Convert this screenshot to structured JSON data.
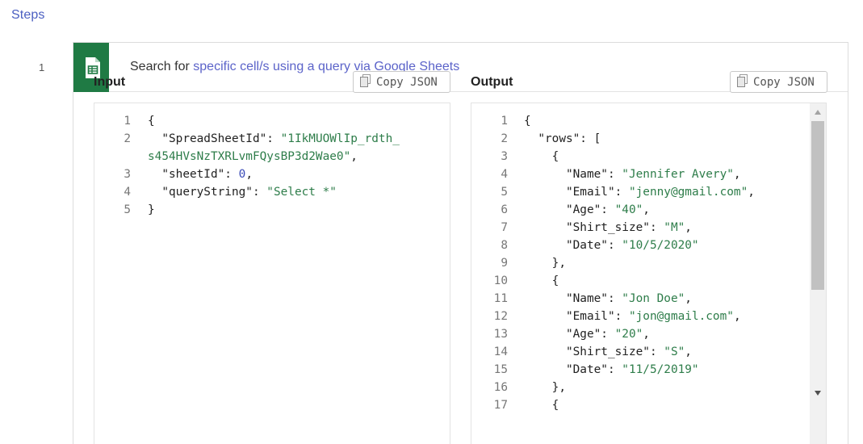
{
  "steps_heading": "Steps",
  "step": {
    "number": "1",
    "app_icon": "google-sheets-icon",
    "app_color": "#1f7a44",
    "title_prefix": "Search for ",
    "title_link": "specific cell/s using a query via Google Sheets"
  },
  "input": {
    "label": "Input",
    "copy_label": "Copy JSON",
    "lines": [
      {
        "n": "1",
        "parts": [
          [
            "code",
            "{"
          ]
        ]
      },
      {
        "n": "2",
        "parts": [
          [
            "code",
            "  \"SpreadSheetId\": "
          ],
          [
            "str",
            "\"1IkMUOWlIp_rdth_"
          ]
        ]
      },
      {
        "n": "",
        "parts": [
          [
            "str",
            "s454HVsNzTXRLvmFQysBP3d2Wae0\""
          ],
          [
            "code",
            ","
          ]
        ]
      },
      {
        "n": "3",
        "parts": [
          [
            "code",
            "  \"sheetId\": "
          ],
          [
            "num",
            "0"
          ],
          [
            "code",
            ","
          ]
        ]
      },
      {
        "n": "4",
        "parts": [
          [
            "code",
            "  \"queryString\": "
          ],
          [
            "str",
            "\"Select *\""
          ]
        ]
      },
      {
        "n": "5",
        "parts": [
          [
            "code",
            "}"
          ]
        ]
      }
    ]
  },
  "output": {
    "label": "Output",
    "copy_label": "Copy JSON",
    "lines": [
      {
        "n": "1",
        "parts": [
          [
            "code",
            "{"
          ]
        ]
      },
      {
        "n": "2",
        "parts": [
          [
            "code",
            "  \"rows\": ["
          ]
        ]
      },
      {
        "n": "3",
        "parts": [
          [
            "code",
            "    {"
          ]
        ]
      },
      {
        "n": "4",
        "parts": [
          [
            "code",
            "      \"Name\": "
          ],
          [
            "str",
            "\"Jennifer Avery\""
          ],
          [
            "code",
            ","
          ]
        ]
      },
      {
        "n": "5",
        "parts": [
          [
            "code",
            "      \"Email\": "
          ],
          [
            "str",
            "\"jenny@gmail.com\""
          ],
          [
            "code",
            ","
          ]
        ]
      },
      {
        "n": "6",
        "parts": [
          [
            "code",
            "      \"Age\": "
          ],
          [
            "str",
            "\"40\""
          ],
          [
            "code",
            ","
          ]
        ]
      },
      {
        "n": "7",
        "parts": [
          [
            "code",
            "      \"Shirt_size\": "
          ],
          [
            "str",
            "\"M\""
          ],
          [
            "code",
            ","
          ]
        ]
      },
      {
        "n": "8",
        "parts": [
          [
            "code",
            "      \"Date\": "
          ],
          [
            "str",
            "\"10/5/2020\""
          ]
        ]
      },
      {
        "n": "9",
        "parts": [
          [
            "code",
            "    },"
          ]
        ]
      },
      {
        "n": "10",
        "parts": [
          [
            "code",
            "    {"
          ]
        ]
      },
      {
        "n": "11",
        "parts": [
          [
            "code",
            "      \"Name\": "
          ],
          [
            "str",
            "\"Jon Doe\""
          ],
          [
            "code",
            ","
          ]
        ]
      },
      {
        "n": "12",
        "parts": [
          [
            "code",
            "      \"Email\": "
          ],
          [
            "str",
            "\"jon@gmail.com\""
          ],
          [
            "code",
            ","
          ]
        ]
      },
      {
        "n": "13",
        "parts": [
          [
            "code",
            "      \"Age\": "
          ],
          [
            "str",
            "\"20\""
          ],
          [
            "code",
            ","
          ]
        ]
      },
      {
        "n": "14",
        "parts": [
          [
            "code",
            "      \"Shirt_size\": "
          ],
          [
            "str",
            "\"S\""
          ],
          [
            "code",
            ","
          ]
        ]
      },
      {
        "n": "15",
        "parts": [
          [
            "code",
            "      \"Date\": "
          ],
          [
            "str",
            "\"11/5/2019\""
          ]
        ]
      },
      {
        "n": "16",
        "parts": [
          [
            "code",
            "    },"
          ]
        ]
      },
      {
        "n": "17",
        "parts": [
          [
            "code",
            "    {"
          ]
        ]
      }
    ]
  }
}
